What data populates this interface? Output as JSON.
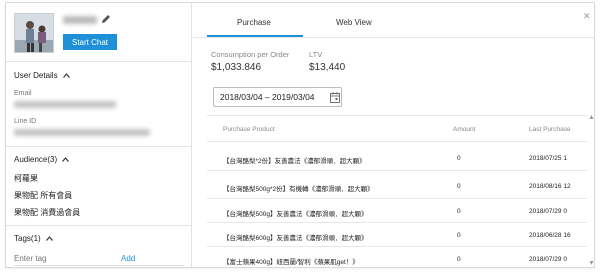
{
  "user": {
    "start_chat_label": "Start Chat"
  },
  "user_details": {
    "heading": "User Details",
    "email_label": "Email",
    "line_id_label": "Line ID"
  },
  "audience": {
    "heading": "Audience(3)",
    "items": [
      "柯蘿果",
      "果物配 所有會員",
      "果物配 消費過會員"
    ]
  },
  "tags": {
    "heading": "Tags(1)",
    "input_placeholder": "Enter tag",
    "add_label": "Add"
  },
  "tabs": [
    "Purchase",
    "Web View"
  ],
  "active_tab": "Purchase",
  "metrics": {
    "consumption_label": "Consumption per Order",
    "consumption_value": "$1,033.846",
    "ltv_label": "LTV",
    "ltv_value": "$13,440"
  },
  "date_range": "2018/03/04 – 2019/03/04",
  "table": {
    "headers": [
      "Purchase Product",
      "Amount",
      "Last Purchase"
    ],
    "rows": [
      [
        "【台灣酪梨*2份】友善農法《濃郁滑順．超大顆》",
        "0",
        "2018/07/25 1"
      ],
      [
        "【台灣酪梨500g*2份】有機轉《濃郁滑順．超大顆》",
        "0",
        "2018/08/16 12"
      ],
      [
        "【台灣酪梨500g】友善農法《濃郁滑順．超大顆》",
        "0",
        "2018/07/29 0"
      ],
      [
        "【台灣酪梨600g】友善農法《濃郁滑順．超大顆》",
        "0",
        "2018/06/28 16"
      ],
      [
        "【富士蘋果400g】紐西蘭/智利《蘋果肌get！》",
        "0",
        "2018/07/29 0"
      ]
    ]
  },
  "colors": {
    "accent": "#1e90d8"
  }
}
